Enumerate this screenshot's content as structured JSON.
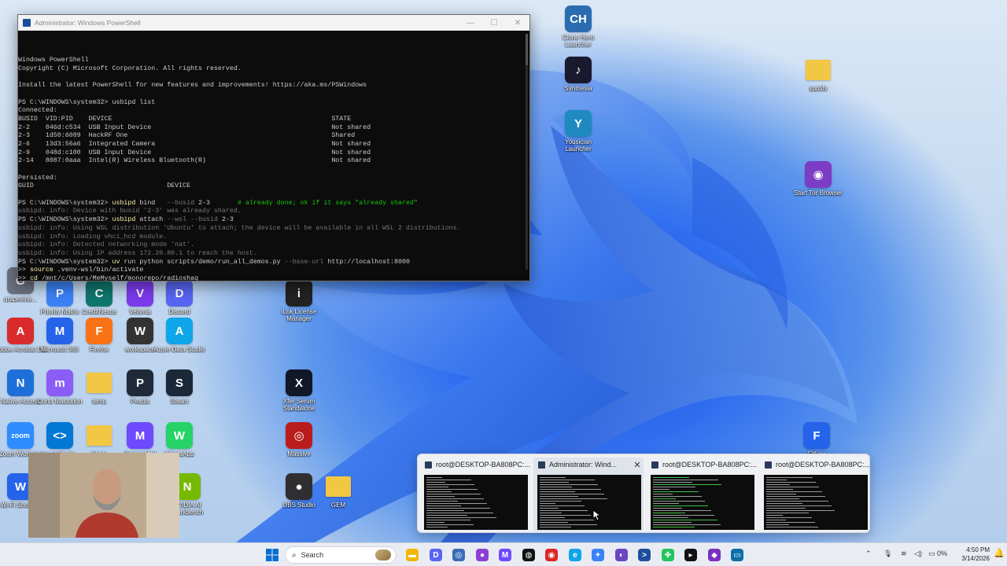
{
  "terminal": {
    "title": "Administrator: Windows PowerShell",
    "lines": [
      {
        "t": "Windows PowerShell",
        "c": ""
      },
      {
        "t": "Copyright (C) Microsoft Corporation. All rights reserved.",
        "c": ""
      },
      {
        "t": "",
        "c": ""
      },
      {
        "t": "Install the latest PowerShell for new features and improvements! https://aka.ms/PSWindows",
        "c": ""
      },
      {
        "t": "",
        "c": ""
      },
      {
        "t": "PS C:\\WINDOWS\\system32> usbipd list",
        "c": ""
      },
      {
        "t": "Connected:",
        "c": ""
      },
      {
        "t": "BUSID  VID:PID    DEVICE                                                        STATE",
        "c": ""
      },
      {
        "t": "2-2    046d:c534  USB Input Device                                              Not shared",
        "c": ""
      },
      {
        "t": "2-3    1d50:6089  HackRF One                                                    Shared",
        "c": ""
      },
      {
        "t": "2-6    13d3:56a6  Integrated Camera                                             Not shared",
        "c": ""
      },
      {
        "t": "2-9    048d:c100  USB Input Device                                              Not shared",
        "c": ""
      },
      {
        "t": "2-14   8087:0aaa  Intel(R) Wireless Bluetooth(R)                                Not shared",
        "c": ""
      },
      {
        "t": "",
        "c": ""
      },
      {
        "t": "Persisted:",
        "c": ""
      },
      {
        "t": "GUID                                  DEVICE",
        "c": ""
      },
      {
        "t": "",
        "c": ""
      },
      {
        "t": "PS C:\\WINDOWS\\system32> usbipd bind   --busid 2-3       # already done; ok if it says \"already shared\"",
        "c": "cmd-comment"
      },
      {
        "t": "usbipd: info: Device with busid '2-3' was already shared.",
        "c": "dim"
      },
      {
        "t": "PS C:\\WINDOWS\\system32> usbipd attach --wsl --busid 2-3",
        "c": "cmd"
      },
      {
        "t": "usbipd: info: Using WSL distribution 'Ubuntu' to attach; the device will be available in all WSL 2 distributions.",
        "c": "dim"
      },
      {
        "t": "usbipd: info: Loading vhci_hcd module.",
        "c": "dim"
      },
      {
        "t": "usbipd: info: Detected networking mode 'nat'.",
        "c": "dim"
      },
      {
        "t": "usbipd: info: Using IP address 172.20.80.1 to reach the host.",
        "c": "dim"
      },
      {
        "t": "PS C:\\WINDOWS\\system32> uv run python scripts/demo/run_all_demos.py --base-url http://localhost:8000",
        "c": "cmd"
      },
      {
        "t": ">> source .venv-wsl/bin/activate",
        "c": "cmd"
      },
      {
        "t": ">> cd /mnt/c/Users/MeMyself/monorepo/radioshaq",
        "c": "cmd"
      }
    ]
  },
  "desktop_icons": [
    {
      "id": "clone-hero",
      "label": "Clone Hero Launcher",
      "glyph": "CH",
      "color": "#2b6cb0"
    },
    {
      "id": "synthesia",
      "label": "Synthesia",
      "glyph": "♪",
      "color": "#1a1a2e"
    },
    {
      "id": "yousician",
      "label": "Yousician Launcher",
      "glyph": "Y",
      "color": "#1f8ac0"
    },
    {
      "id": "spotify",
      "label": "spotify",
      "glyph": "",
      "color": "#f2c744"
    },
    {
      "id": "tor",
      "label": "Start Tor Browser",
      "glyph": "◉",
      "color": "#7d3cc5"
    },
    {
      "id": "grapevine",
      "label": "grapevine...",
      "glyph": "G",
      "color": "#6b7280"
    },
    {
      "id": "priority",
      "label": "Priority Matrix",
      "glyph": "P",
      "color": "#3b82f6"
    },
    {
      "id": "creditnexus",
      "label": "CreditNexus",
      "glyph": "C",
      "color": "#0f766e"
    },
    {
      "id": "vellynia",
      "label": "Vellynia",
      "glyph": "V",
      "color": "#7c3aed"
    },
    {
      "id": "discord",
      "label": "Discord",
      "glyph": "D",
      "color": "#5865f2"
    },
    {
      "id": "ilok",
      "label": "iLok License Manager",
      "glyph": "i",
      "color": "#222"
    },
    {
      "id": "acrobat",
      "label": "Adobe Acrobat DC",
      "glyph": "A",
      "color": "#d92b2b"
    },
    {
      "id": "m365",
      "label": "Microsoft 365",
      "glyph": "M",
      "color": "#2563eb"
    },
    {
      "id": "firefox",
      "label": "Firefox",
      "glyph": "F",
      "color": "#f97316"
    },
    {
      "id": "workspace",
      "label": "workspace",
      "glyph": "W",
      "color": "#333"
    },
    {
      "id": "azuredata",
      "label": "Azure Data Studio",
      "glyph": "A",
      "color": "#0ea5e9"
    },
    {
      "id": "native",
      "label": "Native Access",
      "glyph": "N",
      "color": "#1e6fd9"
    },
    {
      "id": "mastodon",
      "label": "Corto Mastodon",
      "glyph": "m",
      "color": "#8b5cf6"
    },
    {
      "id": "temp",
      "label": "temp",
      "glyph": "",
      "color": "#f2c744"
    },
    {
      "id": "pexdis",
      "label": "Pexdis",
      "glyph": "P",
      "color": "#1f2937"
    },
    {
      "id": "steam",
      "label": "Steam",
      "glyph": "S",
      "color": "#1b2838"
    },
    {
      "id": "xfer",
      "label": "Xfer Serum Standalone",
      "glyph": "X",
      "color": "#111827"
    },
    {
      "id": "zoom",
      "label": "Zoom Workpl...",
      "glyph": "zoom",
      "color": "#2d8cff"
    },
    {
      "id": "vscode",
      "label": "Visual Studio...",
      "glyph": "<>",
      "color": "#0078d4"
    },
    {
      "id": "folder2",
      "label": "Chats",
      "glyph": "",
      "color": "#f2c744"
    },
    {
      "id": "mail",
      "label": "Proton Mail",
      "glyph": "M",
      "color": "#6d4aff"
    },
    {
      "id": "whatsapp",
      "label": "WhatsApp",
      "glyph": "W",
      "color": "#25d366"
    },
    {
      "id": "massive",
      "label": "Massive",
      "glyph": "◎",
      "color": "#b91c1c"
    },
    {
      "id": "wifi",
      "label": "Wi-Fi Shortcut",
      "glyph": "W",
      "color": "#2563eb"
    },
    {
      "id": "nvidia",
      "label": "NVIDIA AI Workbench",
      "glyph": "N",
      "color": "#76b900"
    },
    {
      "id": "obs",
      "label": "OBS Studio",
      "glyph": "●",
      "color": "#302e31"
    },
    {
      "id": "gem",
      "label": "GEM",
      "glyph": "",
      "color": "#f2c744"
    },
    {
      "id": "fitlog",
      "label": "FitLog",
      "glyph": "F",
      "color": "#2563eb"
    }
  ],
  "thumbnails": [
    {
      "title": "root@DESKTOP-BA808PC:...",
      "active": false
    },
    {
      "title": "Administrator: Wind...",
      "active": true
    },
    {
      "title": "root@DESKTOP-BA808PC:...",
      "active": false
    },
    {
      "title": "root@DESKTOP-BA808PC:...",
      "active": false
    }
  ],
  "taskbar": {
    "search_placeholder": "Search",
    "apps": [
      {
        "name": "file-explorer-icon",
        "glyph": "▬",
        "color": "#f2b705"
      },
      {
        "name": "discord-icon",
        "glyph": "D",
        "color": "#5865f2"
      },
      {
        "name": "browser-icon",
        "glyph": "◎",
        "color": "#3b6cb7"
      },
      {
        "name": "app-purple-icon",
        "glyph": "●",
        "color": "#8b3fd6"
      },
      {
        "name": "proton-mail-icon",
        "glyph": "M",
        "color": "#6d4aff"
      },
      {
        "name": "chatgpt-icon",
        "glyph": "◍",
        "color": "#111"
      },
      {
        "name": "chrome-icon",
        "glyph": "◉",
        "color": "#dc2626"
      },
      {
        "name": "edge-icon",
        "glyph": "e",
        "color": "#0ea5e9"
      },
      {
        "name": "tool-icon",
        "glyph": "✦",
        "color": "#3b82f6"
      },
      {
        "name": "github-icon",
        "glyph": "◐",
        "color": "#6b46c1"
      },
      {
        "name": "powershell-icon",
        "glyph": ">",
        "color": "#1f4e9c"
      },
      {
        "name": "pinwheel-icon",
        "glyph": "✤",
        "color": "#22c55e"
      },
      {
        "name": "cursor-icon",
        "glyph": "▸",
        "color": "#111"
      },
      {
        "name": "visual-studio-icon",
        "glyph": "◆",
        "color": "#7b2fbf"
      },
      {
        "name": "terminal-icon",
        "glyph": "▭",
        "color": "#0f6fa8"
      }
    ],
    "battery": "0%",
    "time": "4:50 PM",
    "date": "3/14/2026"
  }
}
